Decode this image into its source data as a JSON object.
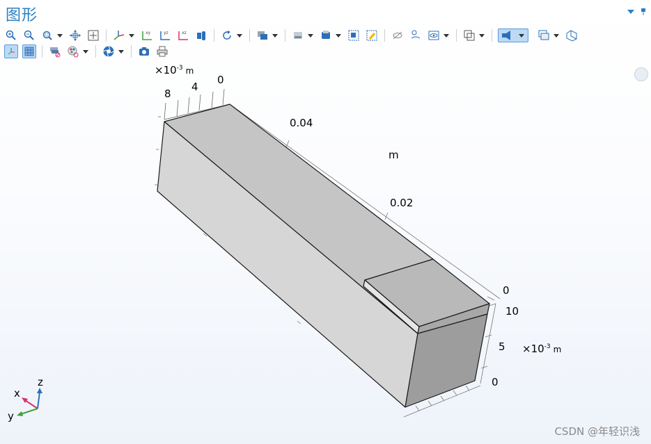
{
  "window": {
    "title": "图形"
  },
  "axes": {
    "top_exp": "×10",
    "top_exp_power": "-3",
    "top_unit": "m",
    "top_ticks": [
      "8",
      "4",
      "0"
    ],
    "long_ticks": [
      "0.04",
      "0.02"
    ],
    "long_unit": "m",
    "right_ticks": [
      "0",
      "10",
      "5",
      "0"
    ],
    "right_exp": "×10",
    "right_exp_power": "-3",
    "right_unit": "m"
  },
  "triad": {
    "x": "x",
    "y": "y",
    "z": "z"
  },
  "watermark": "CSDN @年轻识浅",
  "colors": {
    "accent": "#2a7fc1",
    "active_bg": "#bcd9f6"
  },
  "toolbar_row1": [
    "zoom-in-icon",
    "zoom-out-icon",
    "zoom-box-icon",
    "pan-icon",
    "zoom-extents-icon",
    "view-3d-icon",
    "view-xy-icon",
    "view-yz-icon",
    "view-xz-icon",
    "light-icon",
    "rotate-icon",
    "render-icon",
    "wireframe-icon",
    "transparency-icon",
    "select-box-icon",
    "deselect-icon",
    "hide-icon",
    "show-icon",
    "view-menu-icon",
    "grid-icon",
    "scene-light-icon",
    "copy-window-icon",
    "window-icon"
  ],
  "toolbar_row2": [
    "axis-orient-icon",
    "grid-toggle-icon",
    "clip-icon",
    "color-icon",
    "aperture-icon",
    "camera-icon",
    "print-icon"
  ]
}
